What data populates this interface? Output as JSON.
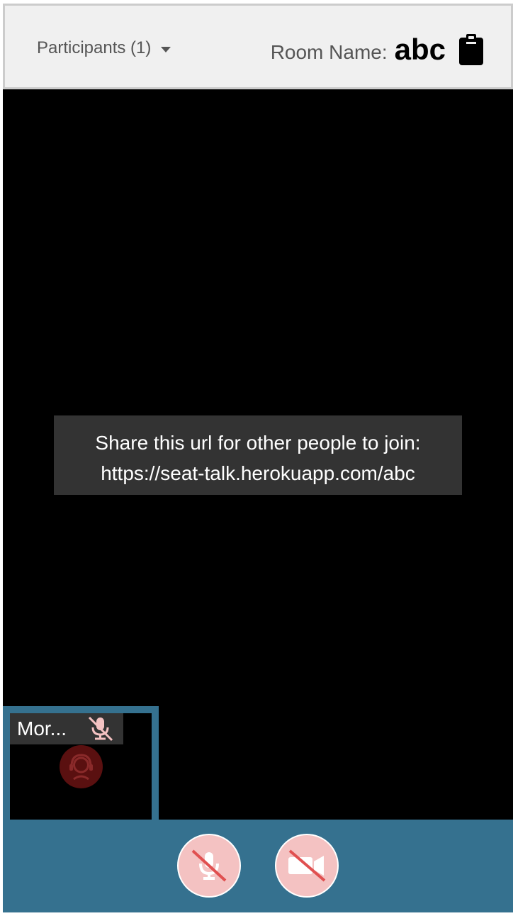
{
  "header": {
    "participants_label": "Participants (1)",
    "room_label": "Room Name:",
    "room_name": "abc"
  },
  "share": {
    "line1": "Share this url for other people to join:",
    "line2": "https://seat-talk.herokuapp.com/abc"
  },
  "local_tile": {
    "name": "Mor...",
    "mic_icon": "mic-muted-icon",
    "avatar_icon": "user-avatar-icon"
  },
  "controls": {
    "mic_button_icon": "mic-off-icon",
    "camera_button_icon": "camera-off-icon"
  },
  "colors": {
    "bar_blue": "#35718f",
    "muted_pink": "#f4c2c2",
    "muted_red": "#e05050"
  }
}
